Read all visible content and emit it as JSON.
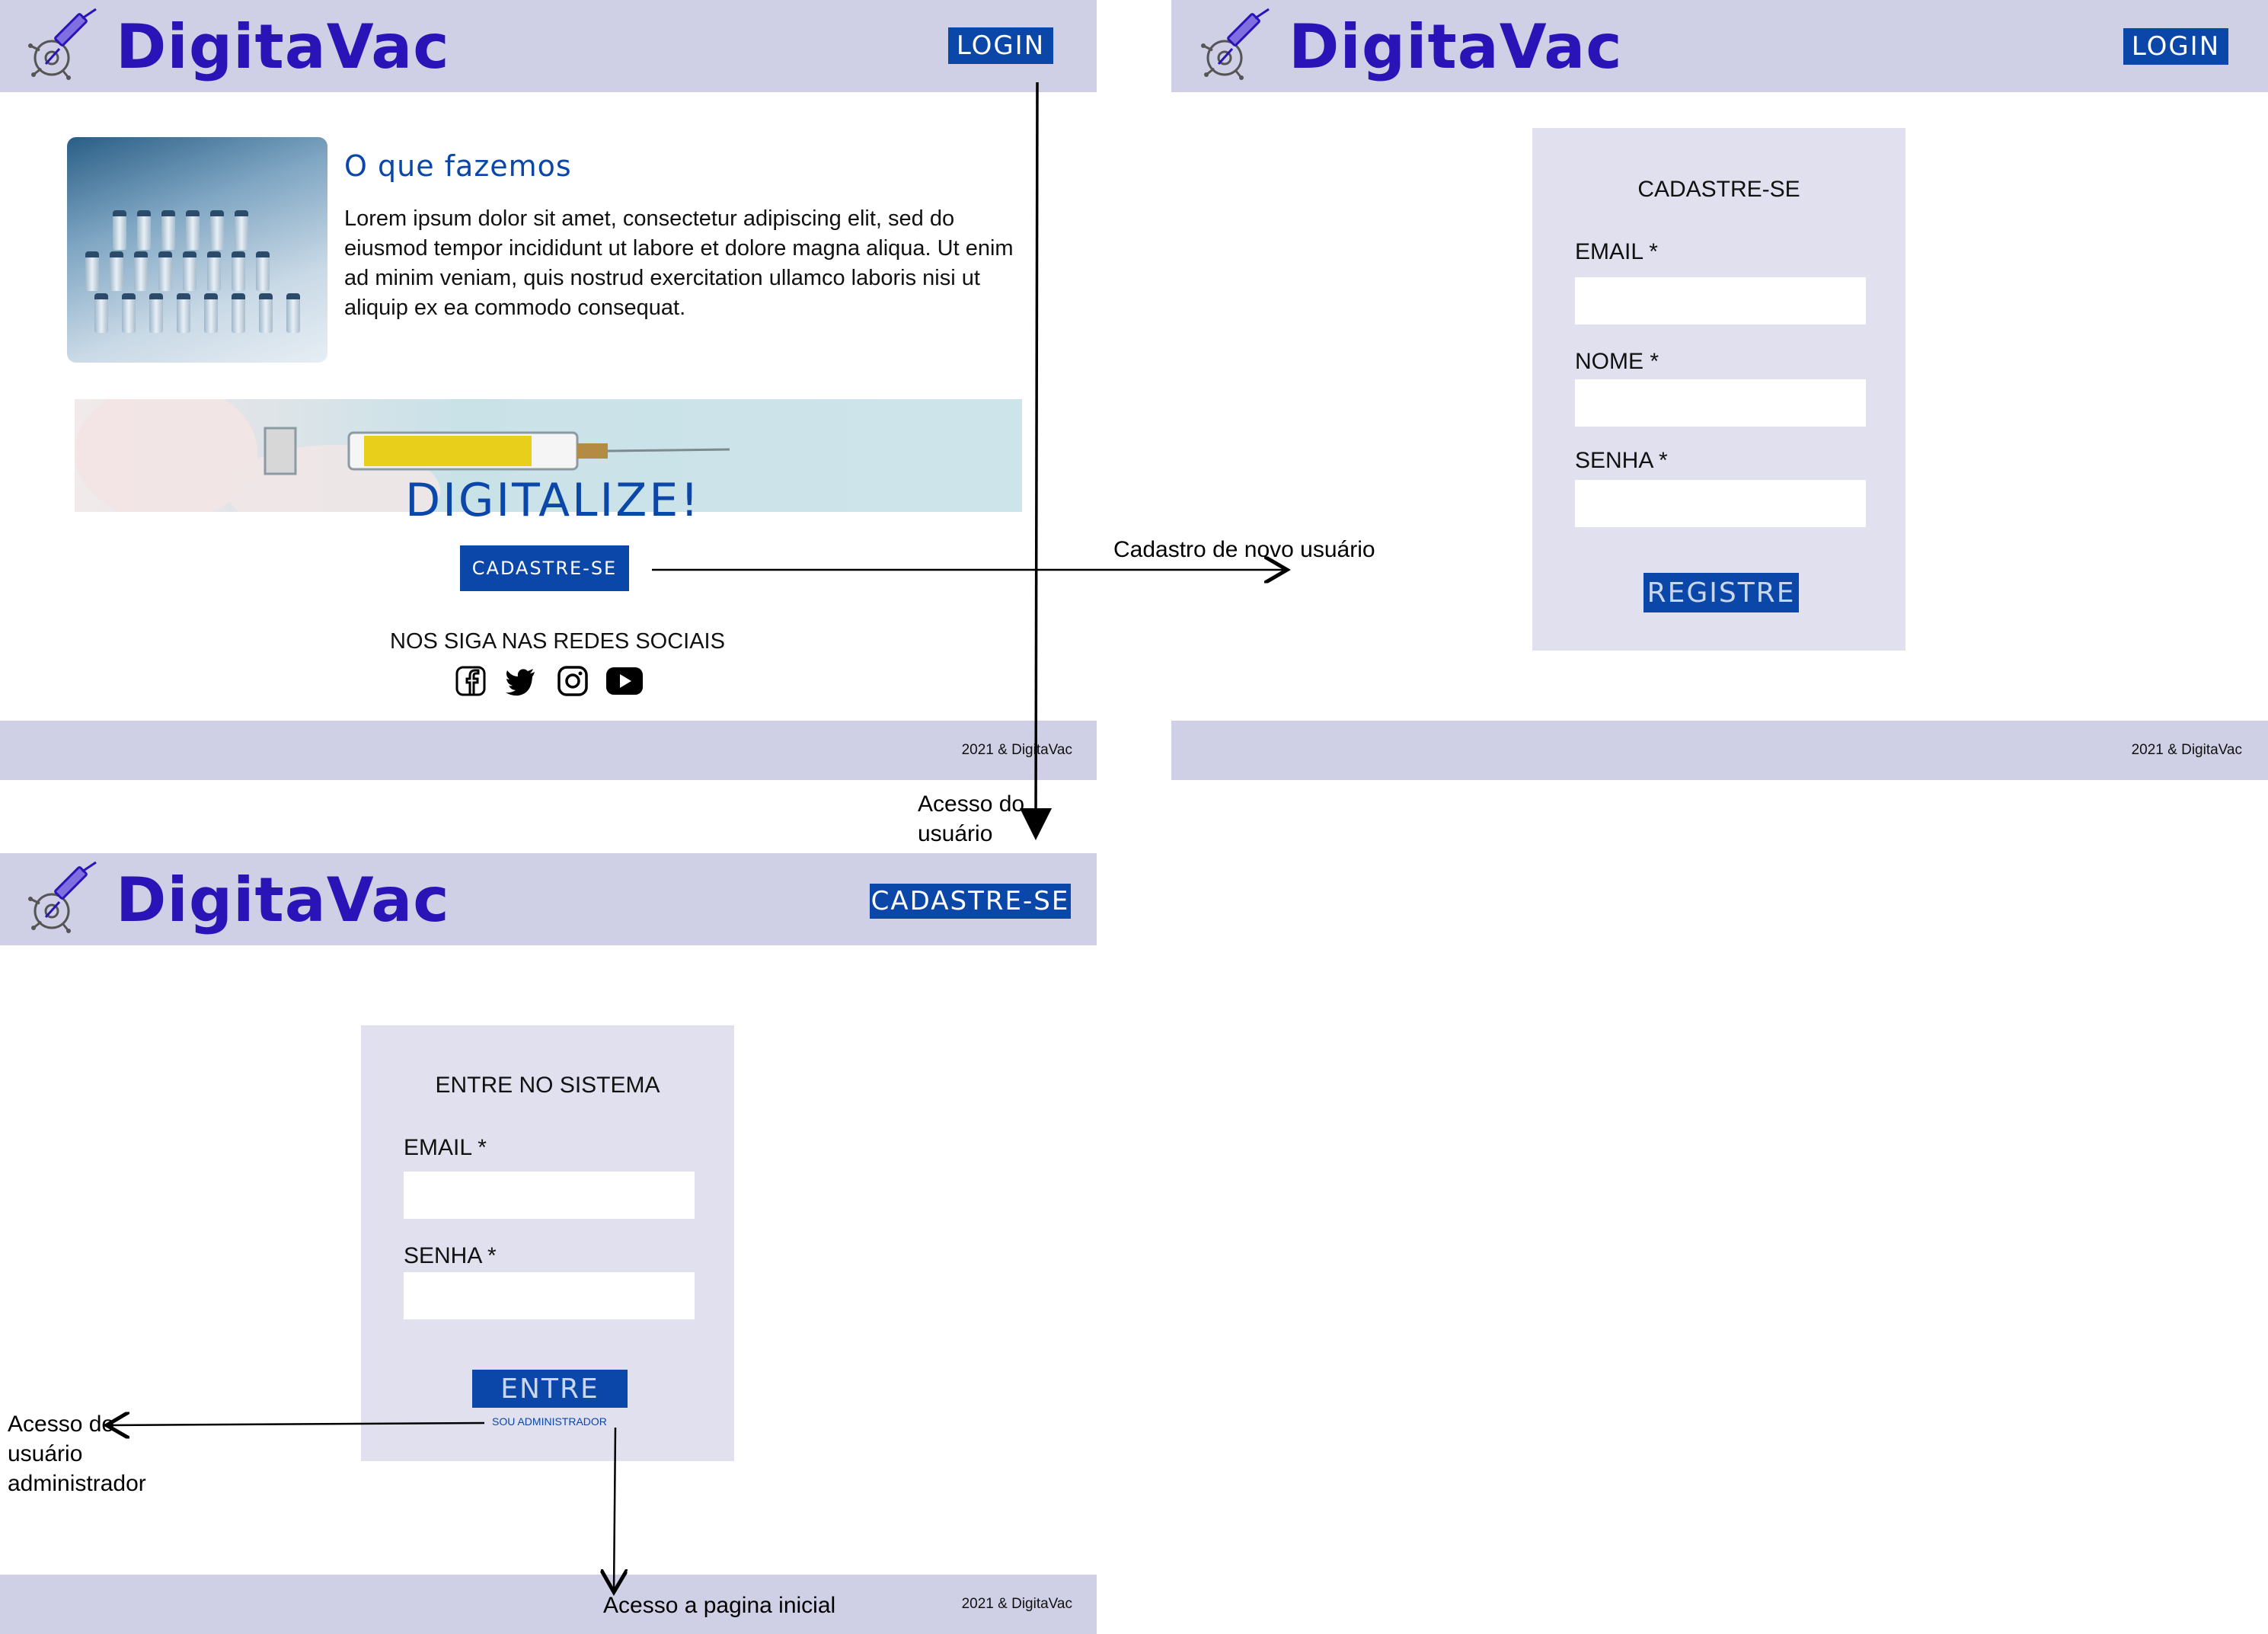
{
  "brand": {
    "name": "DigitaVac",
    "accent_color": "#2a14b8",
    "button_color": "#0b47a8",
    "header_color": "#cfcfe6",
    "logo_icon": "syringe-circuit-icon"
  },
  "home": {
    "login_label": "LOGIN",
    "what_title": "O que fazemos",
    "what_text": "Lorem ipsum dolor sit amet, consectetur adipiscing elit, sed do eiusmod tempor incididunt ut labore et dolore magna aliqua. Ut enim ad minim veniam, quis nostrud exercitation ullamco laboris nisi ut aliquip ex ea commodo consequat.",
    "banner_text": "DIGITALIZE!",
    "signup_label": "CADASTRE-SE",
    "social_title": "NOS SIGA NAS REDES SOCIAIS",
    "social_icons": [
      "facebook-icon",
      "twitter-icon",
      "instagram-icon",
      "youtube-icon"
    ],
    "footer": "2021 & DigitaVac"
  },
  "register": {
    "login_label": "LOGIN",
    "title": "CADASTRE-SE",
    "email_label": "EMAIL *",
    "name_label": "NOME *",
    "password_label": "SENHA *",
    "submit_label": "REGISTRE",
    "footer": "2021 & DigitaVac"
  },
  "login": {
    "signup_label": "CADASTRE-SE",
    "title": "ENTRE NO SISTEMA",
    "email_label": "EMAIL *",
    "password_label": "SENHA *",
    "submit_label": "ENTRE",
    "admin_link": "SOU ADMINISTRADOR",
    "footer": "2021 & DigitaVac"
  },
  "annotations": {
    "new_user": "Cadastro de novo usuário",
    "user_access": [
      "Acesso do",
      "usuário"
    ],
    "admin_access": [
      "Acesso do",
      "usuário",
      "administrador"
    ],
    "home_access": "Acesso a pagina inicial"
  }
}
